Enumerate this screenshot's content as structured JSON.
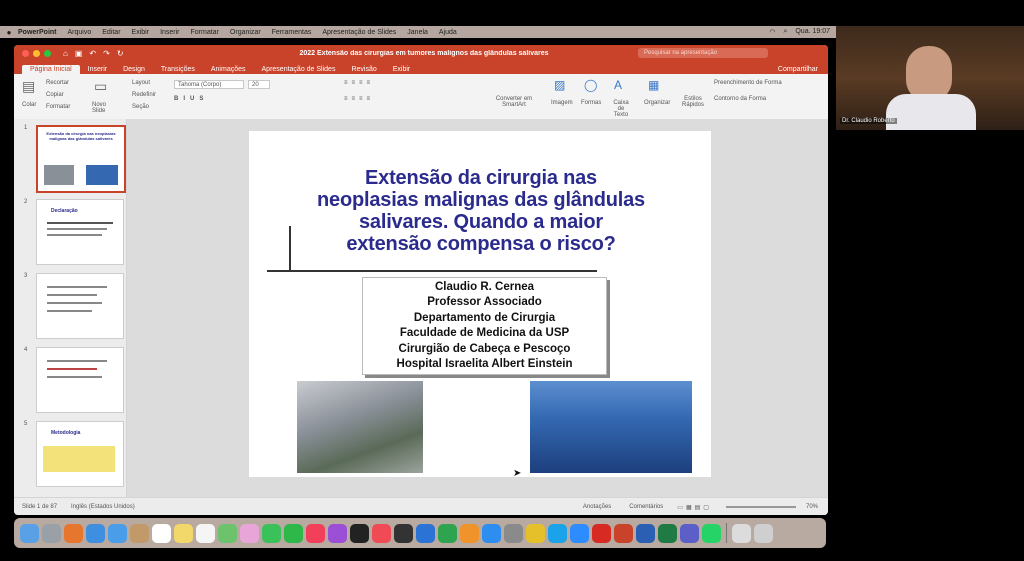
{
  "menubar": {
    "app_name": "PowerPoint",
    "menus": [
      "Arquivo",
      "Editar",
      "Exibir",
      "Inserir",
      "Formatar",
      "Organizar",
      "Ferramentas",
      "Apresentação de Slides",
      "Janela",
      "Ajuda"
    ],
    "clock": "Qua. 19:07"
  },
  "window": {
    "title": "2022 Extensão das cirurgias em tumores malignos das glândulas salivares",
    "search_placeholder": "Pesquisar na apresentação",
    "tabs": [
      "Página Inicial",
      "Inserir",
      "Design",
      "Transições",
      "Animações",
      "Apresentação de Slides",
      "Revisão",
      "Exibir"
    ],
    "share_label": "Compartilhar"
  },
  "ribbon": {
    "paste": "Colar",
    "cut": "Recortar",
    "copy": "Copiar",
    "format": "Formatar",
    "new_slide": "Novo Slide",
    "layout": "Layout",
    "reset": "Redefinir",
    "section": "Seção",
    "font_name": "Tahoma (Corpo)",
    "font_size": "20",
    "convert_smartart": "Converter em SmartArt",
    "image": "Imagem",
    "shapes": "Formas",
    "text_box": "Caixa de Texto",
    "arrange": "Organizar",
    "quick_styles": "Estilos Rápidos",
    "shape_fill": "Preenchimento de Forma",
    "shape_outline": "Contorno da Forma"
  },
  "thumbnails": [
    {
      "num": "1",
      "label": "Extensão da cirurgia nas neoplasias malignas das glândulas salivares"
    },
    {
      "num": "2",
      "label": "Declaração"
    },
    {
      "num": "3",
      "label": ""
    },
    {
      "num": "4",
      "label": ""
    },
    {
      "num": "5",
      "label": "Metodologia"
    }
  ],
  "slide": {
    "title_lines": [
      "Extensão da cirurgia nas",
      "neoplasias malignas das glândulas",
      "salivares. Quando a maior",
      "extensão compensa o risco?"
    ],
    "author_lines": [
      "Claudio R. Cernea",
      "Professor Associado",
      "Departamento de Cirurgia",
      "Faculdade de Medicina da USP",
      "Cirurgião de Cabeça e Pescoço",
      "Hospital Israelita Albert Einstein"
    ]
  },
  "statusbar": {
    "slide_count": "Slide 1 de 87",
    "language": "Inglês (Estados Unidos)",
    "notes": "Anotações",
    "comments": "Comentários",
    "zoom": "70%"
  },
  "webcam": {
    "participant_name": "Dr. Claudio Roberto"
  },
  "colors": {
    "accent": "#c9422a",
    "slide_title": "#2b2b8e"
  },
  "dock_icons": [
    "finder-icon",
    "launchpad-icon",
    "firefox-icon",
    "safari-icon",
    "mail-icon",
    "contacts-icon",
    "calendar-icon",
    "notes-icon",
    "reminders-icon",
    "maps-icon",
    "photos-icon",
    "messages-icon",
    "facetime-icon",
    "music-icon",
    "podcasts-icon",
    "tv-icon",
    "news-icon",
    "stocks-icon",
    "keynote-icon",
    "numbers-icon",
    "pages-icon",
    "app-store-icon",
    "system-preferences-icon",
    "chrome-icon",
    "skype-icon",
    "zoom-icon",
    "acrobat-icon",
    "powerpoint-icon",
    "word-icon",
    "excel-icon",
    "teams-icon",
    "whatsapp-icon",
    "preview-icon",
    "trash-icon"
  ]
}
